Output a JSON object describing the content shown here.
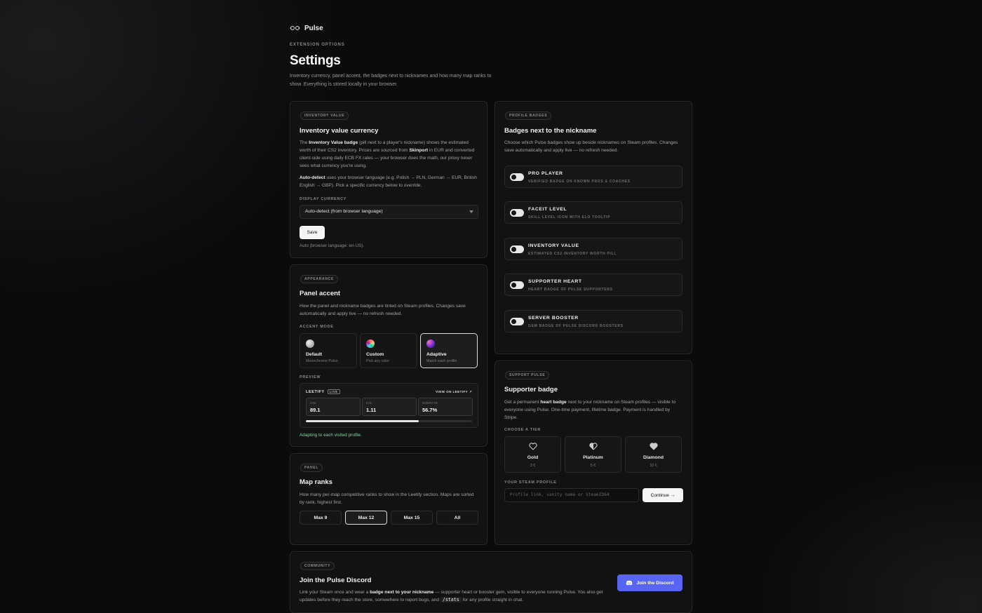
{
  "brand": {
    "name": "Pulse"
  },
  "header": {
    "eyebrow": "EXTENSION OPTIONS",
    "title": "Settings",
    "description": "Inventory currency, panel accent, the badges next to nicknames and how many map ranks to show. Everything is stored locally in your browser."
  },
  "currency": {
    "chip": "INVENTORY VALUE",
    "title": "Inventory value currency",
    "p1_a": "The ",
    "p1_b": "Inventory Value badge",
    "p1_c": " (pill next to a player's nickname) shows the estimated worth of their CS2 inventory. Prices are sourced from ",
    "p1_d": "Skinport",
    "p1_e": " in EUR and converted client-side using daily ECB FX rates — your browser does the math, our proxy never sees what currency you're using.",
    "p2_a": "Auto-detect",
    "p2_b": " uses your browser language (e.g. Polish → PLN, German → EUR, British English → GBP). Pick a specific currency below to override.",
    "display_label": "DISPLAY CURRENCY",
    "selected": "Auto-detect (from browser language)",
    "save_label": "Save",
    "status": "Auto (browser language: en-US)."
  },
  "appearance": {
    "chip": "APPEARANCE",
    "title": "Panel accent",
    "desc": "How the panel and nickname badges are tinted on Steam profiles. Changes save automatically and apply live — no refresh needed.",
    "mode_label": "ACCENT MODE",
    "modes": [
      {
        "title": "Default",
        "sub": "Monochrome Pulse"
      },
      {
        "title": "Custom",
        "sub": "Pick any color"
      },
      {
        "title": "Adaptive",
        "sub": "Match each profile"
      }
    ],
    "preview_label": "PREVIEW",
    "preview": {
      "brand": "LEETIFY",
      "live": "LIVE",
      "link": "VIEW ON LEETIFY ↗",
      "stats": [
        {
          "key": "AIM",
          "value": "89.1"
        },
        {
          "key": "K/D",
          "value": "1.11"
        },
        {
          "key": "WINRATE",
          "value": "56.7%"
        }
      ],
      "progress": 0.68
    },
    "adaptive_note": "Adapting to each visited profile."
  },
  "maps": {
    "chip": "PANEL",
    "title": "Map ranks",
    "desc": "How many per-map competitive ranks to show in the Leetify section. Maps are sorted by rank, highest first.",
    "options": [
      "Max 9",
      "Max 12",
      "Max 15",
      "All"
    ],
    "selected": "Max 12"
  },
  "badges": {
    "chip": "PROFILE BADGES",
    "title": "Badges next to the nickname",
    "desc": "Choose which Pulse badges show up beside nicknames on Steam profiles. Changes save automatically and apply live — no refresh needed.",
    "items": [
      {
        "title": "PRO PLAYER",
        "sub": "VERIFIED BADGE ON KNOWN PROS & COACHES"
      },
      {
        "title": "FACEIT LEVEL",
        "sub": "SKILL LEVEL ICON WITH ELO TOOLTIP"
      },
      {
        "title": "INVENTORY VALUE",
        "sub": "ESTIMATED CS2 INVENTORY WORTH PILL"
      },
      {
        "title": "SUPPORTER HEART",
        "sub": "HEART BADGE OF PULSE SUPPORTERS"
      },
      {
        "title": "SERVER BOOSTER",
        "sub": "GEM BADGE OF PULSE DISCORD BOOSTERS"
      }
    ]
  },
  "support": {
    "chip": "SUPPORT PULSE",
    "title": "Supporter badge",
    "desc_a": "Get a permanent ",
    "desc_b": "heart badge",
    "desc_c": " next to your nickname on Steam profiles — visible to everyone using Pulse. One-time payment, lifetime badge. Payment is handled by Stripe.",
    "tier_label": "CHOOSE A TIER",
    "tiers": [
      {
        "name": "Gold",
        "price": "3 €"
      },
      {
        "name": "Platinum",
        "price": "5 €"
      },
      {
        "name": "Diamond",
        "price": "10 €"
      }
    ],
    "profile_label": "YOUR STEAM PROFILE",
    "profile_placeholder": "Profile link, vanity name or SteamID64",
    "continue_label": "Continue →"
  },
  "community": {
    "chip": "COMMUNITY",
    "title": "Join the Pulse Discord",
    "desc_a": "Link your Steam once and wear a ",
    "desc_b": "badge next to your nickname",
    "desc_c": " — supporter heart or booster gem, visible to everyone running Pulse. You also get updates before they reach the store, somewhere to report bugs, and ",
    "desc_code": "/stats",
    "desc_d": " for any profile straight in chat.",
    "button": "Join the Discord"
  }
}
